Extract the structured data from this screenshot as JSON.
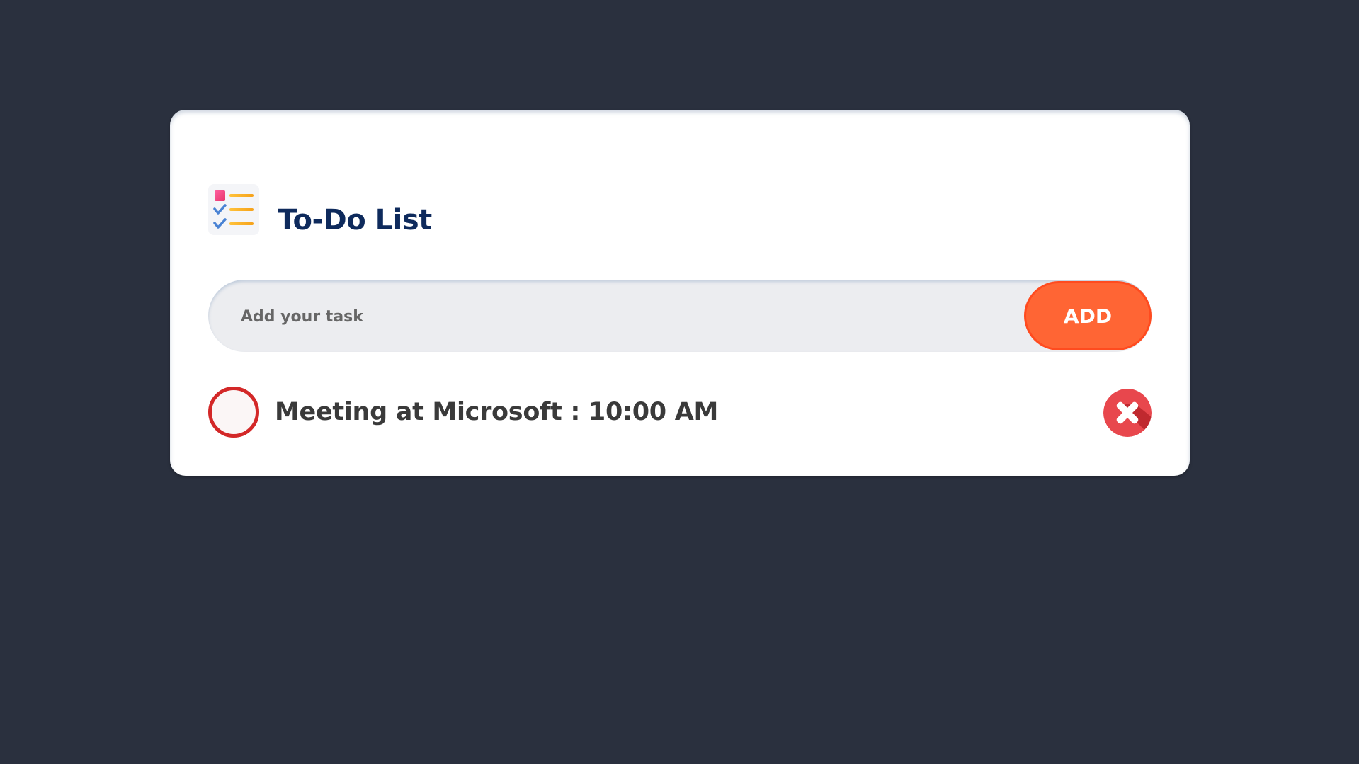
{
  "app": {
    "title": "To-Do List",
    "icon": "checklist-icon"
  },
  "input": {
    "placeholder": "Add your task",
    "value": ""
  },
  "add_button": {
    "label": "ADD"
  },
  "tasks": [
    {
      "text": "Meeting at Microsoft : 10:00 AM",
      "checked": false,
      "delete_icon": "close-icon"
    }
  ],
  "colors": {
    "background": "#2a303e",
    "card": "#ffffff",
    "title": "#0e2a5c",
    "accent": "#ff6534",
    "checkbox_border": "#d32828",
    "delete": "#e8474d"
  }
}
